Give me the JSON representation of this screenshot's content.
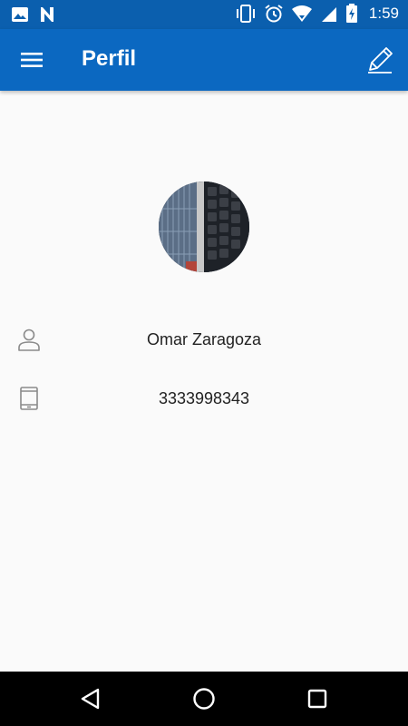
{
  "status_bar": {
    "time": "1:59",
    "left_icons": [
      "image-icon",
      "n-notification-icon"
    ],
    "right_icons": [
      "vibrate-icon",
      "alarm-icon",
      "wifi-icon",
      "signal-icon",
      "battery-charging-icon"
    ]
  },
  "app_bar": {
    "title": "Perfil",
    "left_icon": "menu-icon",
    "right_icon": "edit-icon",
    "background": "#0b68c1"
  },
  "profile": {
    "avatar_icon": "profile-photo",
    "name": "Omar Zaragoza",
    "name_icon": "person-icon",
    "phone": "3333998343",
    "phone_icon": "tablet-icon"
  },
  "nav_bar": {
    "buttons": [
      "back-icon",
      "home-icon",
      "recents-icon"
    ]
  }
}
